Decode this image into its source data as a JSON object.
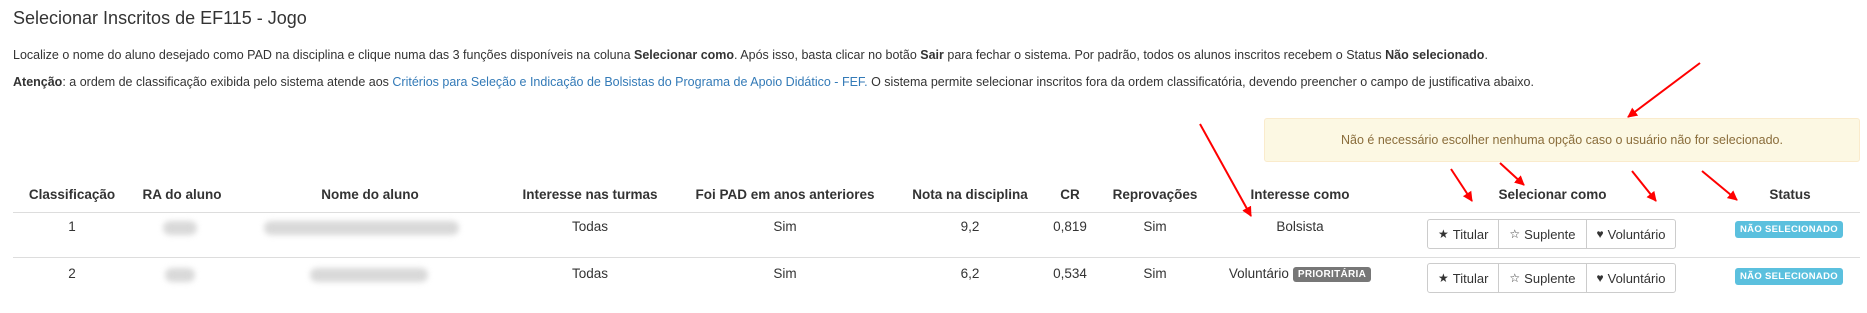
{
  "page": {
    "title": "Selecionar Inscritos de EF115 - Jogo"
  },
  "instructions": {
    "p1_a": "Localize o nome do aluno desejado como PAD na disciplina e clique numa das 3 funções disponíveis na coluna ",
    "p1_b": "Selecionar como",
    "p1_c": ". Após isso, basta clicar no botão ",
    "p1_d": "Sair",
    "p1_e": " para fechar o sistema. Por padrão, todos os alunos inscritos recebem o Status ",
    "p1_f": "Não selecionado",
    "p1_g": ".",
    "p2_a": "Atenção",
    "p2_b": ": a ordem de classificação exibida pelo sistema atende aos ",
    "p2_link": "Critérios para Seleção e Indicação de Bolsistas do Programa de Apoio Didático - FEF.",
    "p2_c": " O sistema permite selecionar inscritos fora da ordem classificatória, devendo preencher o campo de justificativa abaixo."
  },
  "alert": {
    "text": "Não é necessário escolher nenhuma opção caso o usuário não for selecionado."
  },
  "table": {
    "headers": {
      "classificacao": "Classificação",
      "ra": "RA do aluno",
      "nome": "Nome do aluno",
      "interesse_turmas": "Interesse nas turmas",
      "foi_pad": "Foi PAD em anos anteriores",
      "nota": "Nota na disciplina",
      "cr": "CR",
      "reprovacoes": "Reprovações",
      "interesse_como": "Interesse como",
      "selecionar_como": "Selecionar como",
      "status": "Status"
    },
    "rows": [
      {
        "classificacao": "1",
        "interesse_turmas": "Todas",
        "foi_pad": "Sim",
        "nota": "9,2",
        "cr": "0,819",
        "reprovacoes": "Sim",
        "interesse_como": "Bolsista",
        "badge": "",
        "status": "NÃO SELECIONADO"
      },
      {
        "classificacao": "2",
        "interesse_turmas": "Todas",
        "foi_pad": "Sim",
        "nota": "6,2",
        "cr": "0,534",
        "reprovacoes": "Sim",
        "interesse_como": "Voluntário",
        "badge": "PRIORITÁRIA",
        "status": "NÃO SELECIONADO"
      }
    ],
    "buttons": {
      "titular": "Titular",
      "suplente": "Suplente",
      "voluntario": "Voluntário"
    }
  },
  "icons": {
    "titular": "star-filled-icon",
    "suplente": "star-outline-icon",
    "voluntario": "heart-icon",
    "annotation": "red-arrow-icon"
  },
  "colors": {
    "status_badge": "#5bc0de",
    "priority_badge": "#777777",
    "alert_bg": "#fcf8e3",
    "alert_text": "#8a6d3b",
    "link": "#337ab7",
    "annotation_arrow": "#ff0000"
  }
}
